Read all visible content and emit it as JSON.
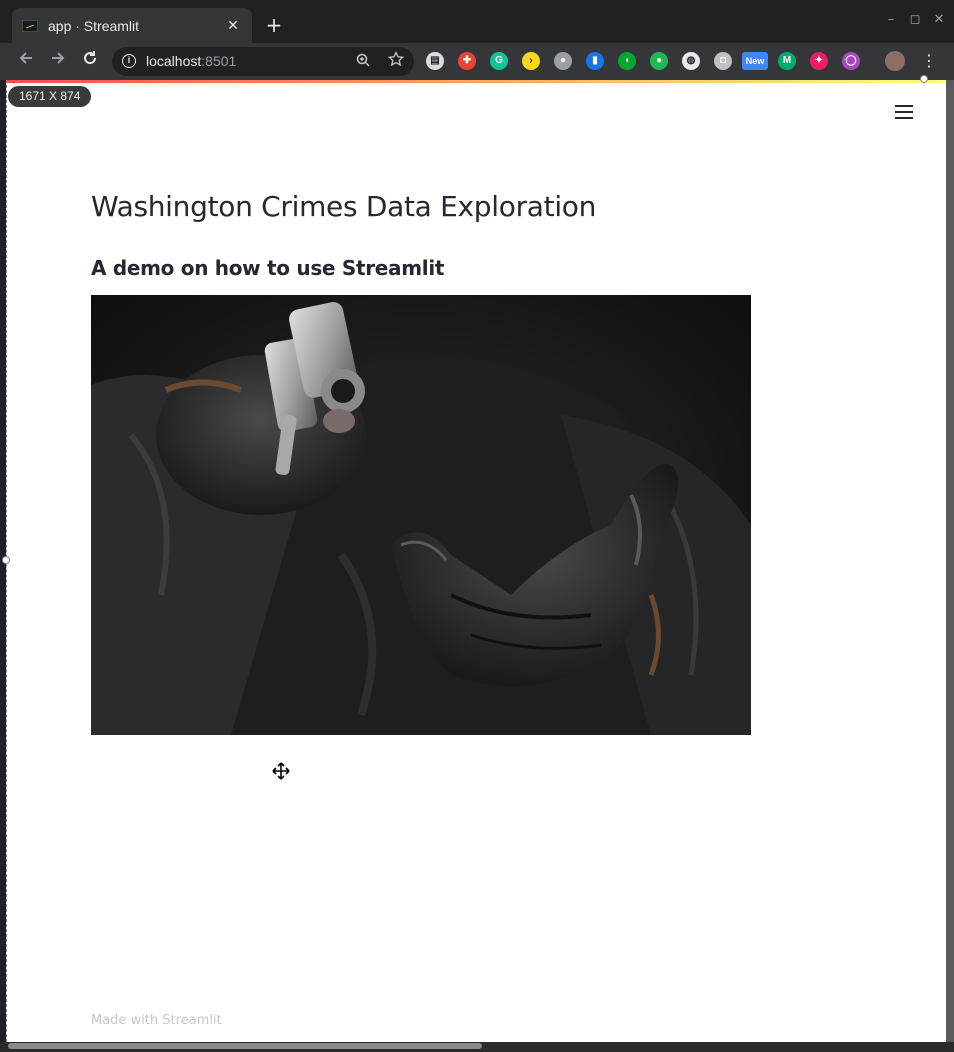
{
  "browser": {
    "tab_title": "app · Streamlit",
    "tab_close": "✕",
    "new_tab": "+",
    "window_controls": [
      "–",
      "◻",
      "✕"
    ],
    "url_host": "localhost",
    "url_port": ":8501",
    "extensions": [
      {
        "name": "document-extension-icon",
        "glyph": "▤",
        "color": "#dadce0"
      },
      {
        "name": "medical-extension-icon",
        "glyph": "✚",
        "color": "#ea4335"
      },
      {
        "name": "grammarly-icon",
        "glyph": "G",
        "color": "#15c39a"
      },
      {
        "name": "arrow-extension-icon",
        "glyph": "›",
        "color": "#f9d71c"
      },
      {
        "name": "settings-extension-icon",
        "glyph": "●",
        "color": "#9aa0a6"
      },
      {
        "name": "bookmark-extension-icon",
        "glyph": "▮",
        "color": "#1a73e8"
      },
      {
        "name": "evernote-icon",
        "glyph": "◖",
        "color": "#00a82d"
      },
      {
        "name": "leaf-extension-icon",
        "glyph": "●",
        "color": "#1db954"
      },
      {
        "name": "alien-extension-icon",
        "glyph": "◍",
        "color": "#e8eaed"
      },
      {
        "name": "camera-extension-icon",
        "glyph": "◘",
        "color": "#bdc1c6"
      },
      {
        "name": "new-badge-extension-icon",
        "glyph": "New",
        "color": "#4285f4"
      },
      {
        "name": "medium-icon",
        "glyph": "M",
        "color": "#00ab6c"
      },
      {
        "name": "puzzle-extension-icon",
        "glyph": "✦",
        "color": "#e91e63"
      },
      {
        "name": "ring-extension-icon",
        "glyph": "◯",
        "color": "#ab47bc"
      }
    ]
  },
  "dimension_badge": "1671 X 874",
  "page": {
    "title": "Washington Crimes Data Exploration",
    "subtitle": "A demo on how to use Streamlit",
    "footer": "Made with Streamlit"
  },
  "colors": {
    "accent": "#ff4b4b",
    "text": "#262730",
    "footer_text": "#c4c7cc"
  }
}
